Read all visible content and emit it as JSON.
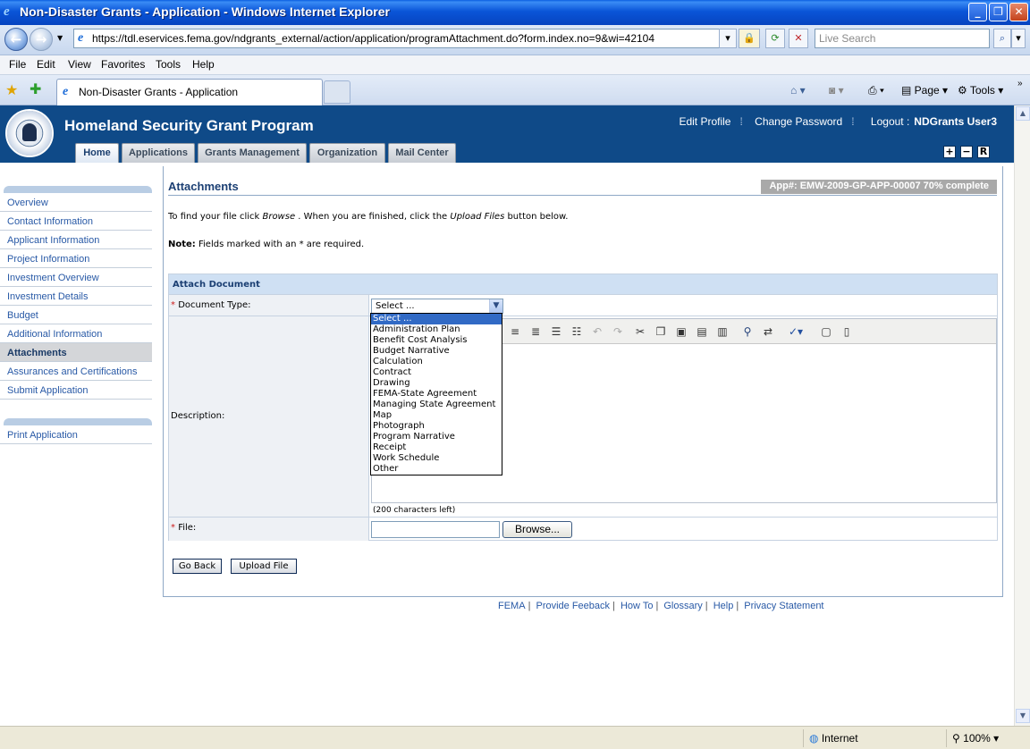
{
  "window": {
    "title": "Non-Disaster Grants - Application - Windows Internet Explorer"
  },
  "address": {
    "url": "https://tdl.eservices.fema.gov/ndgrants_external/action/application/programAttachment.do?form.index.no=9&wi=42104",
    "search_placeholder": "Live Search"
  },
  "menu": [
    "File",
    "Edit",
    "View",
    "Favorites",
    "Tools",
    "Help"
  ],
  "browser_tab": {
    "label": "Non-Disaster Grants - Application"
  },
  "command_bar": {
    "page_label": "Page",
    "tools_label": "Tools"
  },
  "app": {
    "title": "Homeland Security Grant Program",
    "links": {
      "edit_profile": "Edit Profile",
      "change_password": "Change Password",
      "logout_prefix": "Logout :",
      "user": "NDGrants User3"
    },
    "tabs": [
      "Home",
      "Applications",
      "Grants Management",
      "Organization",
      "Mail Center"
    ],
    "size_buttons": [
      "+",
      "−",
      "R"
    ]
  },
  "sidebar": {
    "items": [
      "Overview",
      "Contact Information",
      "Applicant Information",
      "Project Information",
      "Investment Overview",
      "Investment Details",
      "Budget",
      "Additional Information",
      "Attachments",
      "Assurances and Certifications",
      "Submit Application"
    ],
    "active": "Attachments",
    "secondary": [
      "Print Application"
    ]
  },
  "page": {
    "heading": "Attachments",
    "app_number": "App#: EMW-2009-GP-APP-00007 70% complete",
    "instruction_a": "To find your file click ",
    "instruction_browse": "Browse",
    "instruction_b": " . When you are finished, click the ",
    "instruction_upload": "Upload Files",
    "instruction_c": " button below.",
    "note_label": "Note:",
    "note_text": " Fields marked with an * are required."
  },
  "form": {
    "section_title": "Attach Document",
    "document_type_label": "Document Type:",
    "document_type_value": "Select ...",
    "description_label": "Description:",
    "chars_left": "(200 characters left)",
    "file_label": "File:",
    "browse_label": "Browse...",
    "document_type_options": [
      "Select ...",
      "Administration Plan",
      "Benefit Cost Analysis",
      "Budget Narrative",
      "Calculation",
      "Contract",
      "Drawing",
      "FEMA-State Agreement",
      "Managing State Agreement",
      "Map",
      "Photograph",
      "Program Narrative",
      "Receipt",
      "Work Schedule",
      "Other"
    ]
  },
  "buttons": {
    "go_back": "Go Back",
    "upload_file": "Upload File"
  },
  "footer": [
    "FEMA",
    "Provide Feeback",
    "How To",
    "Glossary",
    "Help",
    "Privacy Statement"
  ],
  "status": {
    "zone": "Internet",
    "zoom": "100%"
  }
}
